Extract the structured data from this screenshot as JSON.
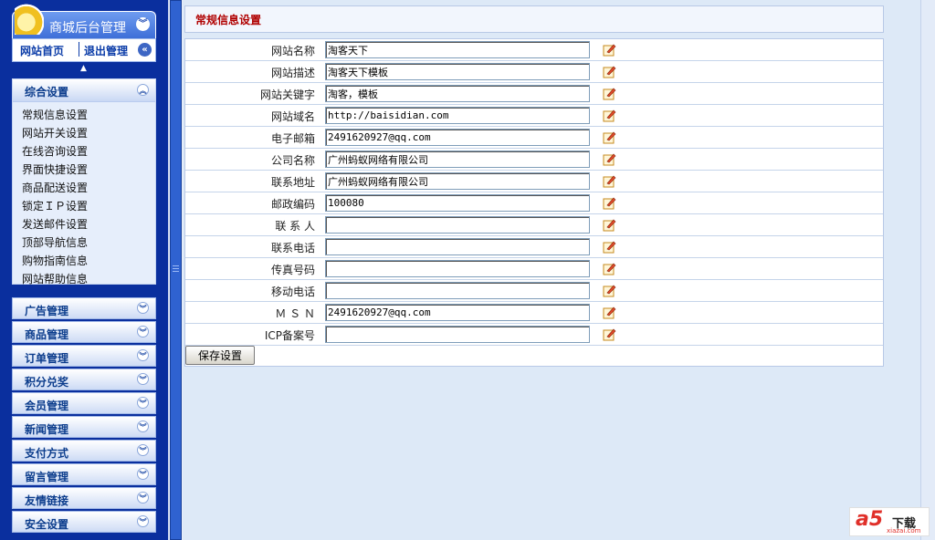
{
  "sidebar": {
    "title": "商城后台管理",
    "top_links": {
      "home": "网站首页",
      "logout": "退出管理"
    },
    "expanded_group": {
      "label": "综合设置",
      "items": [
        "常规信息设置",
        "网站开关设置",
        "在线咨询设置",
        "界面快捷设置",
        "商品配送设置",
        "锁定ＩＰ设置",
        "发送邮件设置",
        "顶部导航信息",
        "购物指南信息",
        "网站帮助信息"
      ]
    },
    "groups": [
      "广告管理",
      "商品管理",
      "订单管理",
      "积分兑奖",
      "会员管理",
      "新闻管理",
      "支付方式",
      "留言管理",
      "友情链接",
      "安全设置"
    ]
  },
  "main": {
    "title": "常规信息设置",
    "fields": [
      {
        "label": "网站名称",
        "value": "淘客天下"
      },
      {
        "label": "网站描述",
        "value": "淘客天下模板"
      },
      {
        "label": "网站关键字",
        "value": "淘客，模板"
      },
      {
        "label": "网站域名",
        "value": "http://baisidian.com"
      },
      {
        "label": "电子邮箱",
        "value": "2491620927@qq.com"
      },
      {
        "label": "公司名称",
        "value": "广州蚂蚁网络有限公司"
      },
      {
        "label": "联系地址",
        "value": "广州蚂蚁网络有限公司"
      },
      {
        "label": "邮政编码",
        "value": "100080"
      },
      {
        "label": "联 系 人",
        "value": ""
      },
      {
        "label": "联系电话",
        "value": ""
      },
      {
        "label": "传真号码",
        "value": ""
      },
      {
        "label": "移动电话",
        "value": ""
      },
      {
        "label": "Ｍ Ｓ Ｎ",
        "value": "2491620927@qq.com"
      },
      {
        "label": "ICP备案号",
        "value": ""
      }
    ],
    "save_label": "保存设置"
  },
  "watermark": {
    "brand": "a5",
    "text": "下载",
    "domain": "xiazai.com"
  },
  "colors": {
    "sidebar_bg": "#0a2f9e",
    "title_red": "#b00000",
    "page_bg": "#dde9f7"
  },
  "icons": {
    "edit": "edit-pencil-icon",
    "expand": "double-chevron-down-icon",
    "collapse": "double-chevron-up-icon"
  }
}
